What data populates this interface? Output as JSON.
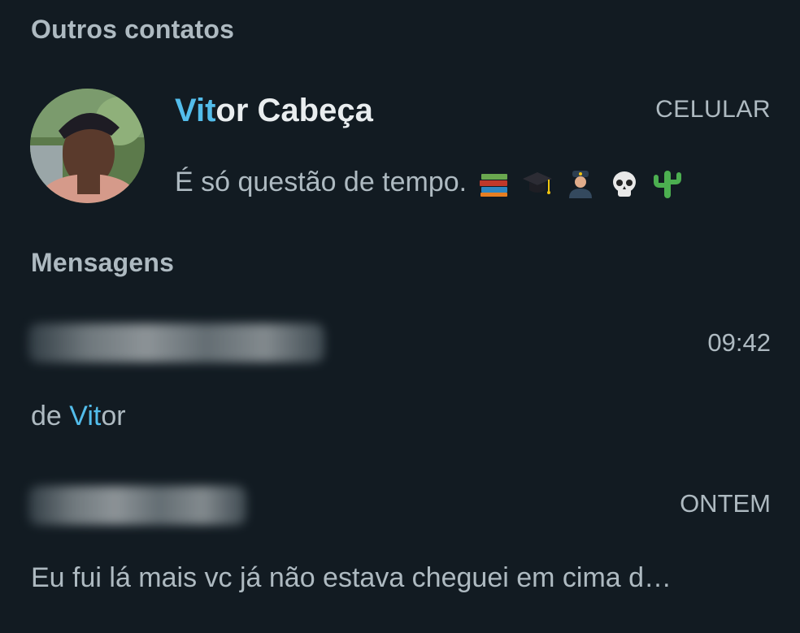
{
  "sections": {
    "other_contacts": "Outros contatos",
    "messages": "Mensagens"
  },
  "contact": {
    "name_highlight": "Vit",
    "name_rest": "or Cabeça",
    "type": "CELULAR",
    "status": "É só questão de tempo.",
    "status_emojis": [
      "books-icon",
      "graduation-cap-icon",
      "police-officer-icon",
      "skull-icon",
      "cactus-icon"
    ]
  },
  "messages": [
    {
      "sender_blurred": true,
      "time": "09:42",
      "preview_prefix": "de ",
      "preview_highlight": "Vit",
      "preview_rest": "or"
    },
    {
      "sender_blurred": true,
      "time": "ONTEM",
      "preview": "Eu fui lá mais vc já não estava cheguei em cima d…"
    }
  ],
  "colors": {
    "background": "#121b22",
    "highlight": "#53bdeb",
    "primary_text": "#e9edef",
    "secondary_text": "#aebac1"
  }
}
